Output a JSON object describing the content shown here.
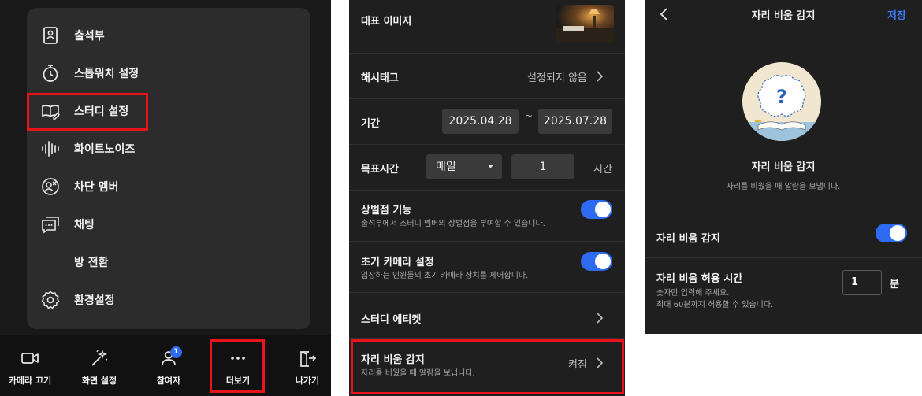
{
  "panel1": {
    "menu": [
      {
        "label": "출석부",
        "icon": "attendance-book-icon"
      },
      {
        "label": "스톱워치 설정",
        "icon": "stopwatch-icon"
      },
      {
        "label": "스터디 설정",
        "icon": "book-edit-icon"
      },
      {
        "label": "화이트노이즈",
        "icon": "sound-wave-icon"
      },
      {
        "label": "차단 멤버",
        "icon": "block-user-icon"
      },
      {
        "label": "채팅",
        "icon": "chat-icon"
      },
      {
        "label": "방 전환",
        "icon": ""
      },
      {
        "label": "환경설정",
        "icon": "gear-icon"
      }
    ],
    "toolbar": [
      {
        "label": "카메라 끄기",
        "icon": "camera-icon"
      },
      {
        "label": "화면 설정",
        "icon": "magic-wand-icon"
      },
      {
        "label": "참여자",
        "icon": "user-icon",
        "badge": "1"
      },
      {
        "label": "더보기",
        "icon": "more-icon"
      },
      {
        "label": "나가기",
        "icon": "exit-icon"
      }
    ]
  },
  "panel2": {
    "rep_image": {
      "label": "대표 이미지"
    },
    "hashtag": {
      "label": "해시태그",
      "value": "설정되지 않음"
    },
    "period": {
      "label": "기간",
      "start": "2025.04.28",
      "sep": "~",
      "end": "2025.07.28"
    },
    "goal": {
      "label": "목표시간",
      "frequency": "매일",
      "hours": "1",
      "unit": "시간"
    },
    "reward": {
      "label": "상벌점 기능",
      "desc": "출석부에서 스터디 멤버의 상벌점을 부여할 수 있습니다.",
      "enabled": true
    },
    "camera": {
      "label": "초기 카메라 설정",
      "desc": "입장하는 인원들의 초기 카메라 장치를 제어합니다.",
      "enabled": true
    },
    "etiquette": {
      "label": "스터디 에티켓"
    },
    "absence": {
      "label": "자리 비움 감지",
      "desc": "자리를 비웠을 때 알람을 보냅니다.",
      "value": "켜짐"
    }
  },
  "panel3": {
    "header": {
      "title": "자리 비움 감지",
      "save": "저장"
    },
    "hero": {
      "title": "자리 비움 감지",
      "desc": "자리를 비웠을 때 알람을 보냅니다.",
      "mark": "?"
    },
    "toggle_row": {
      "label": "자리 비움 감지",
      "enabled": true
    },
    "time_row": {
      "label": "자리 비움 허용 시간",
      "desc1": "숫자만 입력해 주세요.",
      "desc2": "최대 60분까지 허용할 수 있습니다.",
      "value": "1",
      "unit": "분"
    }
  },
  "colors": {
    "accent": "#2f6bf2",
    "highlight": "#e8141a",
    "background": "#1f1f1f",
    "card": "#2c2c2c"
  }
}
